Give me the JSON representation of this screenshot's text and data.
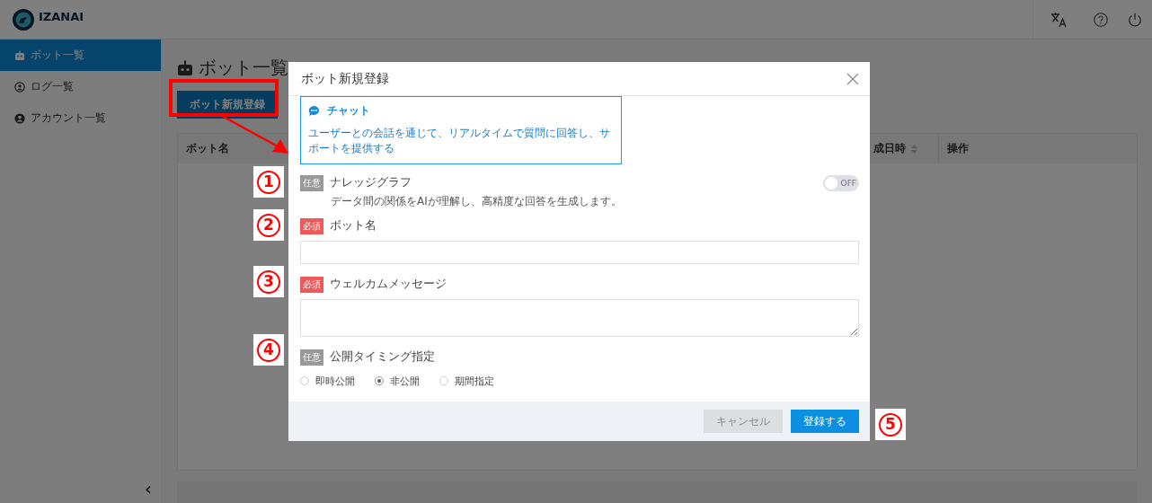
{
  "header": {
    "brand": "IZANAI"
  },
  "sidebar": {
    "items": [
      {
        "label": "ボット一覧",
        "selected": true
      },
      {
        "label": "ログ一覧",
        "selected": false
      },
      {
        "label": "アカウント一覧",
        "selected": false
      }
    ],
    "collapse": "‹"
  },
  "main": {
    "title": "ボット一覧",
    "new_button": "ボット新規登録",
    "table": {
      "columns": [
        "ボット名",
        "成日時",
        "操作"
      ]
    }
  },
  "modal": {
    "title": "ボット新規登録",
    "type_card": {
      "title": "チャット",
      "description": "ユーザーとの会話を通じて、リアルタイムで質問に回答し、サポートを提供する",
      "selected": true
    },
    "fields": [
      {
        "kind": "toggle",
        "badge": "任意",
        "required": false,
        "label": "ナレッジグラフ",
        "description": "データ間の関係をAIが理解し、高精度な回答を生成します。",
        "toggle_text": "OFF",
        "on": false
      },
      {
        "kind": "input",
        "badge": "必須",
        "required": true,
        "label": "ボット名"
      },
      {
        "kind": "textarea",
        "badge": "必須",
        "required": true,
        "label": "ウェルカムメッセージ"
      },
      {
        "kind": "radio",
        "badge": "任意",
        "required": false,
        "label": "公開タイミング指定",
        "options": [
          {
            "label": "即時公開",
            "selected": false
          },
          {
            "label": "非公開",
            "selected": true
          },
          {
            "label": "期間指定",
            "selected": false
          }
        ]
      }
    ],
    "buttons": [
      {
        "label": "キャンセル",
        "kind": "cancel"
      },
      {
        "label": "登録する",
        "kind": "primary"
      }
    ]
  },
  "annotations": {
    "callouts": [
      "1",
      "2",
      "3",
      "4",
      "5"
    ]
  }
}
